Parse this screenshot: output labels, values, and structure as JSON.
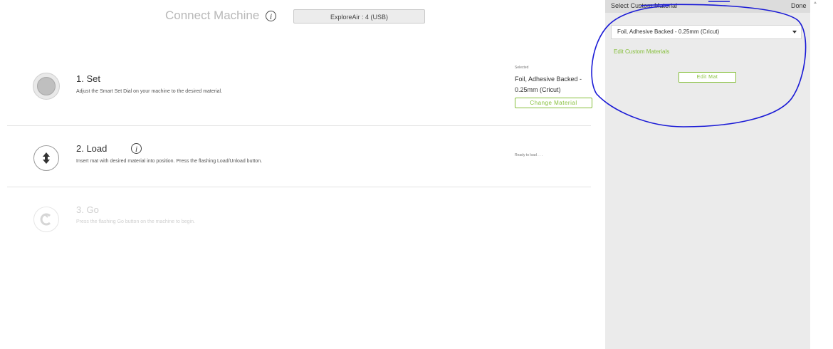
{
  "header": {
    "connect_title": "Connect Machine",
    "info_glyph": "i",
    "machine_button": "ExploreAir : 4 (USB)"
  },
  "steps": [
    {
      "title": "1. Set",
      "description": "Adjust the Smart Set Dial on your machine to the desired material.",
      "icon": "smart-set-dial-icon"
    },
    {
      "title": "2. Load",
      "description": "Insert mat with desired material into position. Press the flashing Load/Unload button.",
      "icon": "load-unload-arrows-icon",
      "status": "Ready to load . . ."
    },
    {
      "title": "3. Go",
      "description": "Press the flashing Go button on the machine to begin.",
      "icon": "cricut-go-icon"
    }
  ],
  "selected_material": {
    "label": "Selected",
    "name": "Foil, Adhesive Backed - 0.25mm (Cricut)",
    "change_button": "Change Material"
  },
  "panel": {
    "title": "Select Custom Material",
    "done": "Done",
    "dropdown_value": "Foil, Adhesive Backed - 0.25mm (Cricut)",
    "edit_link": "Edit Custom Materials",
    "edit_mat_button": "Edit Mat"
  },
  "colors": {
    "accent_green": "#86bf3b",
    "annotation_blue": "#1a1ad6",
    "panel_bg": "#ebebeb"
  }
}
